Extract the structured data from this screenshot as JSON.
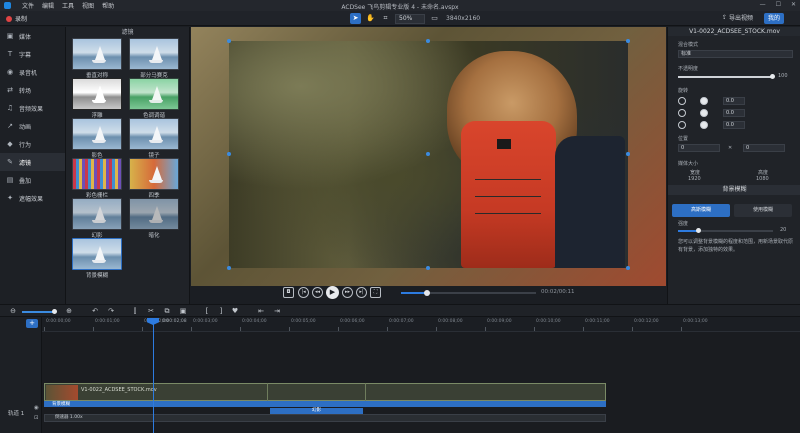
{
  "titlebar": {
    "menu": [
      "文件",
      "编辑",
      "工具",
      "视图",
      "帮助"
    ],
    "title": "ACDSee 飞鸟剪辑专业版 4 - 未命名.avspx",
    "window_buttons": [
      "—",
      "☐",
      "✕"
    ]
  },
  "toolbar": {
    "record_label": "录制",
    "zoom": "50%",
    "resolution": "3840x2160",
    "export_label": "导出视频",
    "mode_label": "我的"
  },
  "leftnav": {
    "items": [
      {
        "icon": "media-icon",
        "glyph": "▣",
        "label": "媒体"
      },
      {
        "icon": "caption-icon",
        "glyph": "T",
        "label": "字幕"
      },
      {
        "icon": "audio-record-icon",
        "glyph": "◉",
        "label": "录音机"
      },
      {
        "icon": "transition-icon",
        "glyph": "⇄",
        "label": "转场"
      },
      {
        "icon": "audio-effect-icon",
        "glyph": "♫",
        "label": "音频效果"
      },
      {
        "icon": "animation-icon",
        "glyph": "↗",
        "label": "动画"
      },
      {
        "icon": "behavior-icon",
        "glyph": "◆",
        "label": "行为"
      },
      {
        "icon": "filter-icon",
        "glyph": "✎",
        "label": "滤镜"
      },
      {
        "icon": "overlay-icon",
        "glyph": "▤",
        "label": "叠加"
      },
      {
        "icon": "visual-effect-icon",
        "glyph": "✦",
        "label": "遮幅效果"
      }
    ],
    "active_index": 7
  },
  "library": {
    "header": "滤镜",
    "thumbs": [
      {
        "label": "垂直对称"
      },
      {
        "label": "部分马赛克"
      },
      {
        "label": "浮雕"
      },
      {
        "label": "色调调谐"
      },
      {
        "label": "影色"
      },
      {
        "label": "镜子"
      },
      {
        "label": "彩色栅栏"
      },
      {
        "label": "四季"
      },
      {
        "label": "幻影"
      },
      {
        "label": "暗化"
      },
      {
        "label": "背景模糊"
      }
    ]
  },
  "player": {
    "buttons": [
      "snapshot",
      "prev-frame",
      "rewind",
      "play",
      "forward",
      "next-frame",
      "fullscreen"
    ],
    "time": "00:02/00:11",
    "progress": 0.18
  },
  "props": {
    "file": "V1-0022_ACDSEE_STOCK.mov",
    "blend_label": "混合模式",
    "blend_value": "标准",
    "opacity_label": "不透明度",
    "opacity_value": "100",
    "rotation_label": "旋转",
    "rot_values": [
      "0.0",
      "0.0",
      "0.0"
    ],
    "position_label": "位置",
    "pos_x": "0",
    "pos_y": "0",
    "size_label": "媒体大小",
    "width_label": "宽度",
    "width_value": "1920",
    "height_label": "高度",
    "height_value": "1080",
    "section_bg": "背景模糊",
    "bg_btn1": "高斯模糊",
    "bg_btn2": "使用模糊",
    "strength_label": "强度",
    "strength_value": "20",
    "desc": "您可以调整背景模糊的程度和范围，用新场景取代原有背景，添加独特的效果。",
    "accent": "#2d6fc4"
  },
  "timeline": {
    "ruler": [
      "0:00:00;00",
      "0:00:01;00",
      "0:00:02;00",
      "0:00:03;00",
      "0:00:04;00",
      "0:00:05;00",
      "0:00:06;00",
      "0:00:07;00",
      "0:00:08;00",
      "0:00:09;00",
      "0:00:10;00",
      "0:00:11;00",
      "0:00:12;00",
      "0:00:13;00"
    ],
    "playhead_time": "0:00:02;08",
    "clip_name": "V1-0022_ACDSEE_STOCK.mov",
    "fx_label": "背景模糊",
    "fx2_label": "幻影",
    "speed_label": "倒速器 1.00x",
    "track_label": "轨道 1"
  }
}
